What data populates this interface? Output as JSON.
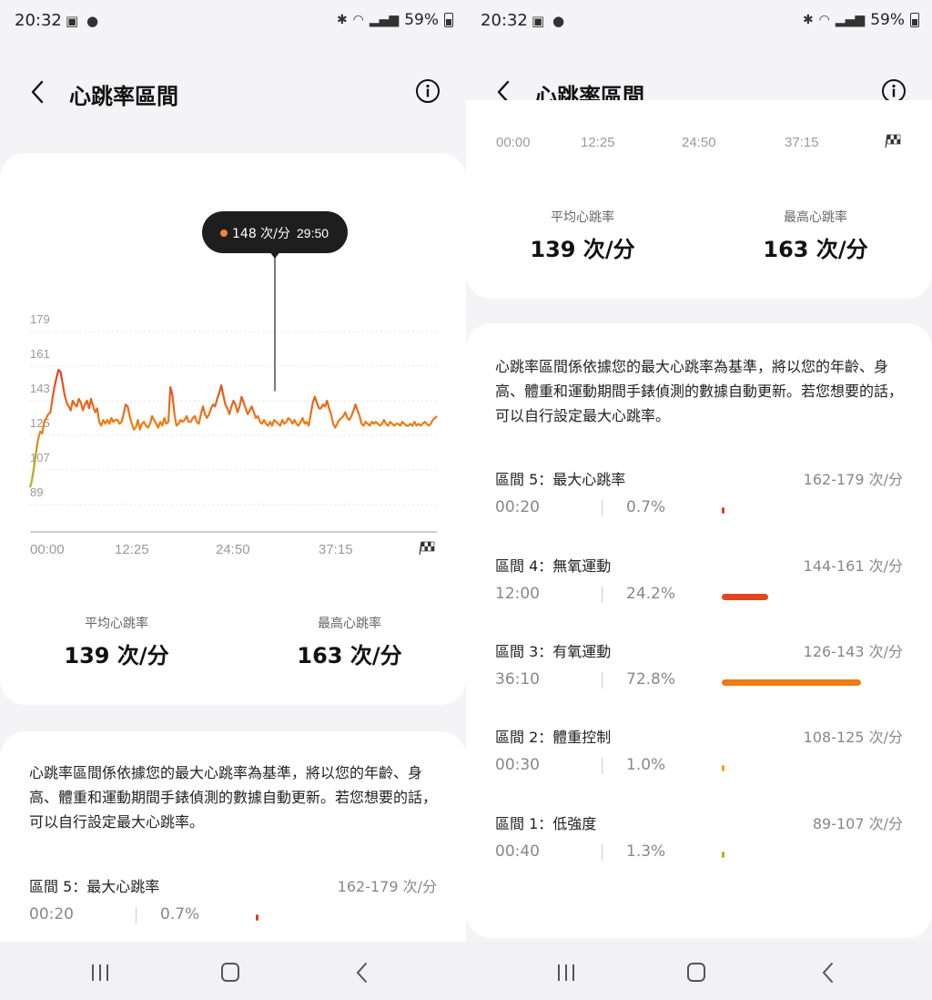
{
  "status": {
    "time": "20:32",
    "battery": "59%"
  },
  "header": {
    "title": "心跳率區間"
  },
  "chart_data": {
    "type": "line",
    "y_ticks": [
      179,
      161,
      143,
      125,
      107,
      89
    ],
    "ylim": [
      80,
      192
    ],
    "x_tick_labels": [
      "00:00",
      "12:25",
      "24:50",
      "37:15"
    ],
    "duration_min": 49,
    "tooltip": {
      "value": "148 次/分",
      "time": "29:50",
      "t_min": 29.83,
      "y": 148
    },
    "series": [
      {
        "points": [
          [
            0,
            98
          ],
          [
            0.4,
            101
          ],
          [
            0.8,
            106
          ],
          [
            1.2,
            112
          ],
          [
            1.6,
            118
          ],
          [
            2,
            123
          ],
          [
            2.5,
            127
          ],
          [
            3,
            126
          ],
          [
            3.5,
            132
          ],
          [
            4,
            134
          ],
          [
            4.5,
            136
          ],
          [
            5,
            137
          ],
          [
            5.5,
            144
          ],
          [
            6,
            150
          ],
          [
            6.5,
            155
          ],
          [
            7,
            159
          ],
          [
            7.5,
            158
          ],
          [
            8,
            152
          ],
          [
            8.5,
            146
          ],
          [
            9,
            142
          ],
          [
            9.5,
            140
          ],
          [
            10,
            138
          ],
          [
            10.5,
            143
          ],
          [
            11,
            141
          ],
          [
            11.5,
            140
          ],
          [
            12,
            144
          ],
          [
            12.5,
            142
          ],
          [
            13,
            138
          ],
          [
            13.5,
            141
          ],
          [
            14,
            143
          ],
          [
            14.5,
            139
          ],
          [
            15,
            144
          ],
          [
            15.5,
            140
          ],
          [
            16,
            137
          ],
          [
            16.5,
            139
          ],
          [
            17,
            132
          ],
          [
            17.5,
            130
          ],
          [
            18,
            133
          ],
          [
            18.5,
            131
          ],
          [
            19,
            133
          ],
          [
            19.5,
            131
          ],
          [
            20,
            134
          ],
          [
            20.5,
            132
          ],
          [
            21,
            133
          ],
          [
            21.5,
            133
          ],
          [
            22,
            131
          ],
          [
            22.5,
            132
          ],
          [
            23,
            136
          ],
          [
            23.5,
            141
          ],
          [
            24,
            140
          ],
          [
            24.5,
            135
          ],
          [
            25,
            131
          ],
          [
            25.5,
            128
          ],
          [
            26,
            129
          ],
          [
            26.5,
            133
          ],
          [
            27,
            128
          ],
          [
            27.5,
            131
          ],
          [
            28,
            132
          ],
          [
            28.5,
            130
          ],
          [
            29,
            129
          ],
          [
            29.5,
            131
          ],
          [
            30,
            135
          ],
          [
            30.5,
            133
          ],
          [
            31,
            131
          ],
          [
            31.5,
            129
          ],
          [
            32,
            132
          ],
          [
            32.5,
            130
          ],
          [
            33,
            134
          ],
          [
            33.5,
            131
          ],
          [
            34,
            132
          ],
          [
            34.5,
            150
          ],
          [
            35,
            146
          ],
          [
            35.5,
            136
          ],
          [
            36,
            130
          ],
          [
            36.5,
            131
          ],
          [
            37,
            133
          ],
          [
            37.5,
            132
          ],
          [
            38,
            133
          ],
          [
            38.5,
            135
          ],
          [
            39,
            132
          ],
          [
            39.5,
            132
          ],
          [
            40,
            134
          ],
          [
            40.5,
            135
          ],
          [
            41,
            132
          ],
          [
            41.5,
            131
          ],
          [
            42,
            136
          ],
          [
            42.5,
            140
          ],
          [
            43,
            136
          ],
          [
            43.5,
            134
          ],
          [
            44,
            136
          ],
          [
            44.5,
            139
          ],
          [
            45,
            141
          ],
          [
            45.5,
            140
          ],
          [
            46,
            144
          ],
          [
            46.5,
            147
          ],
          [
            47,
            151
          ],
          [
            47.5,
            146
          ],
          [
            48,
            141
          ],
          [
            48.5,
            139
          ],
          [
            49,
            136
          ],
          [
            49.5,
            140
          ],
          [
            50,
            143
          ],
          [
            50.5,
            141
          ],
          [
            51,
            137
          ],
          [
            51.5,
            140
          ],
          [
            52,
            145
          ],
          [
            52.5,
            142
          ],
          [
            53,
            139
          ],
          [
            53.5,
            136
          ],
          [
            54,
            138
          ],
          [
            54.5,
            140
          ],
          [
            55,
            137
          ],
          [
            55.5,
            134
          ],
          [
            56,
            135
          ],
          [
            56.5,
            132
          ],
          [
            57,
            131
          ],
          [
            57.5,
            133
          ],
          [
            58,
            131
          ],
          [
            58.5,
            130
          ],
          [
            59,
            132
          ],
          [
            59.5,
            130
          ],
          [
            60,
            133
          ],
          [
            60.5,
            132
          ],
          [
            61,
            131
          ],
          [
            61.5,
            130
          ],
          [
            62,
            133
          ],
          [
            62.5,
            131
          ],
          [
            63,
            132
          ],
          [
            63.5,
            134
          ],
          [
            64,
            133
          ],
          [
            64.5,
            131
          ],
          [
            65,
            133
          ],
          [
            65.5,
            131
          ],
          [
            66,
            130
          ],
          [
            66.5,
            132
          ],
          [
            67,
            134
          ],
          [
            67.5,
            131
          ],
          [
            68,
            132
          ],
          [
            68.5,
            130
          ],
          [
            69,
            136
          ],
          [
            69.5,
            142
          ],
          [
            70,
            145
          ],
          [
            70.5,
            142
          ],
          [
            71,
            139
          ],
          [
            71.5,
            139
          ],
          [
            72,
            141
          ],
          [
            72.5,
            140
          ],
          [
            73,
            143
          ],
          [
            73.5,
            139
          ],
          [
            74,
            136
          ],
          [
            74.5,
            131
          ],
          [
            75,
            129
          ],
          [
            75.5,
            131
          ],
          [
            76,
            133
          ],
          [
            76.5,
            134
          ],
          [
            77,
            135
          ],
          [
            77.5,
            137
          ],
          [
            78,
            134
          ],
          [
            78.5,
            133
          ],
          [
            79,
            135
          ],
          [
            79.5,
            138
          ],
          [
            80,
            141
          ],
          [
            80.5,
            138
          ],
          [
            81,
            135
          ],
          [
            81.5,
            131
          ],
          [
            82,
            130
          ],
          [
            82.5,
            132
          ],
          [
            83,
            131
          ],
          [
            83.5,
            130
          ],
          [
            84,
            132
          ],
          [
            84.5,
            131
          ],
          [
            85,
            132
          ],
          [
            85.5,
            131
          ],
          [
            86,
            130
          ],
          [
            86.5,
            131
          ],
          [
            87,
            133
          ],
          [
            87.5,
            131
          ],
          [
            88,
            130
          ],
          [
            88.5,
            132
          ],
          [
            89,
            131
          ],
          [
            89.5,
            130
          ],
          [
            90,
            131
          ],
          [
            90.5,
            131
          ],
          [
            91,
            130
          ],
          [
            91.5,
            132
          ],
          [
            92,
            131
          ],
          [
            92.5,
            130
          ],
          [
            93,
            130
          ],
          [
            93.5,
            131
          ],
          [
            94,
            130
          ],
          [
            94.5,
            132
          ],
          [
            95,
            130
          ],
          [
            95.5,
            131
          ],
          [
            96,
            130
          ],
          [
            96.5,
            131
          ],
          [
            97,
            132
          ],
          [
            97.5,
            131
          ],
          [
            98,
            130
          ],
          [
            98.5,
            131
          ],
          [
            99,
            133
          ],
          [
            99.5,
            134
          ],
          [
            100,
            135
          ]
        ]
      }
    ]
  },
  "stats": {
    "avg_label": "平均心跳率",
    "avg_value": "139 次/分",
    "max_label": "最高心跳率",
    "max_value": "163 次/分"
  },
  "description": "心跳率區間係依據您的最大心跳率為基準，將以您的年齡、身高、體重和運動期間手錶偵測的數據自動更新。若您想要的話，可以自行設定最大心跳率。",
  "zones": [
    {
      "name": "區間 5：最大心跳率",
      "range": "162-179 次/分",
      "time": "00:20",
      "pct": "0.7%",
      "fraction": 0.007,
      "color": "#d9402a"
    },
    {
      "name": "區間 4：無氧運動",
      "range": "144-161 次/分",
      "time": "12:00",
      "pct": "24.2%",
      "fraction": 0.242,
      "color": "#e2461f"
    },
    {
      "name": "區間 3：有氧運動",
      "range": "126-143 次/分",
      "time": "36:10",
      "pct": "72.8%",
      "fraction": 0.728,
      "color": "#f07a14"
    },
    {
      "name": "區間 2：體重控制",
      "range": "108-125 次/分",
      "time": "00:30",
      "pct": "1.0%",
      "fraction": 0.01,
      "color": "#f0a21e"
    },
    {
      "name": "區間 1：低強度",
      "range": "89-107 次/分",
      "time": "00:40",
      "pct": "1.3%",
      "fraction": 0.013,
      "color": "#9bbf1e"
    }
  ],
  "colors": {
    "accent": "#f07a14",
    "line_high": "#d9402a",
    "line_low": "#9bbf1e",
    "tooltip_bg": "#1e1e1e",
    "tooltip_dot": "#f08040"
  },
  "icons": {
    "back": "back-chevron-icon",
    "info": "info-icon",
    "finish": "checkered-flag-icon"
  }
}
